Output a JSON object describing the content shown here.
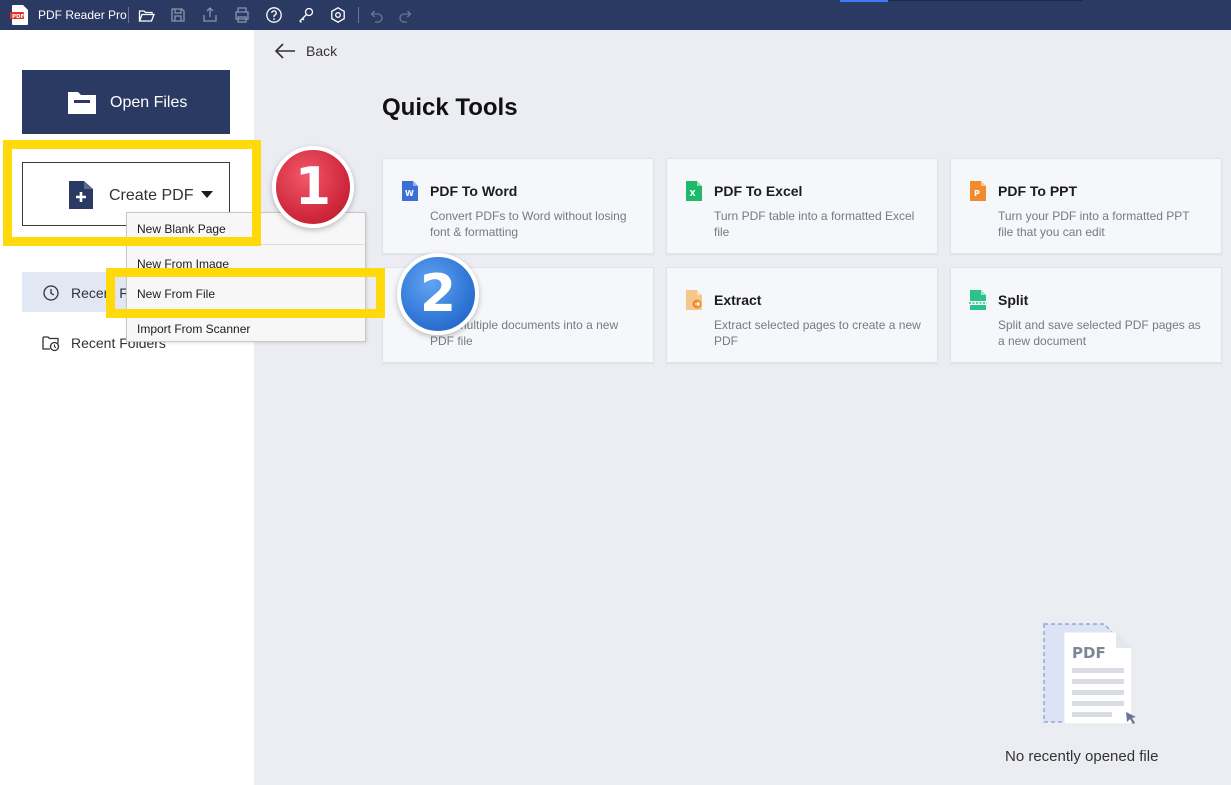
{
  "titlebar": {
    "app_title": "PDF Reader Pro",
    "icons": [
      "open-folder-icon",
      "save-icon",
      "share-icon",
      "print-icon",
      "help-icon",
      "key-icon",
      "settings-icon",
      "undo-icon",
      "redo-icon"
    ]
  },
  "sidebar": {
    "open_files_label": "Open Files",
    "create_pdf_label": "Create PDF",
    "nav": [
      {
        "label": "Recent Fi",
        "icon": "clock-icon"
      },
      {
        "label": "Recent Folders",
        "icon": "folder-clock-icon"
      }
    ]
  },
  "dropdown": {
    "items": [
      "New Blank Page",
      "New From Image",
      "New From File",
      "Import From Scanner"
    ]
  },
  "annotations": {
    "badge_1": "1",
    "badge_2": "2",
    "highlight_color": "#ffd90a"
  },
  "main": {
    "back_label": "Back",
    "title": "Quick Tools",
    "tools": [
      {
        "title": "PDF To Word",
        "desc": "Convert PDFs to Word without losing font & formatting",
        "icon": "word-icon",
        "color": "#3b6fd3"
      },
      {
        "title": "PDF To Excel",
        "desc": "Turn PDF table into a formatted Excel file",
        "icon": "excel-icon",
        "color": "#1fb96b"
      },
      {
        "title": "PDF To PPT",
        "desc": "Turn your PDF into a formatted PPT file that you can edit",
        "icon": "ppt-icon",
        "color": "#f08c2e"
      },
      {
        "title": "",
        "desc": "...ne multiple documents into a new PDF file",
        "icon": "merge-icon",
        "color": "#7a5af5"
      },
      {
        "title": "Extract",
        "desc": "Extract selected pages to create a new PDF",
        "icon": "extract-icon",
        "color": "#f0a040"
      },
      {
        "title": "Split",
        "desc": "Split and save selected PDF pages as a new document",
        "icon": "split-icon",
        "color": "#2cc38a"
      }
    ],
    "empty_text": "No recently opened file",
    "empty_illus_label": "PDF"
  },
  "colors": {
    "titlebar": "#2b3a63",
    "primary_button": "#2b3a63",
    "background": "#ecedf2"
  }
}
